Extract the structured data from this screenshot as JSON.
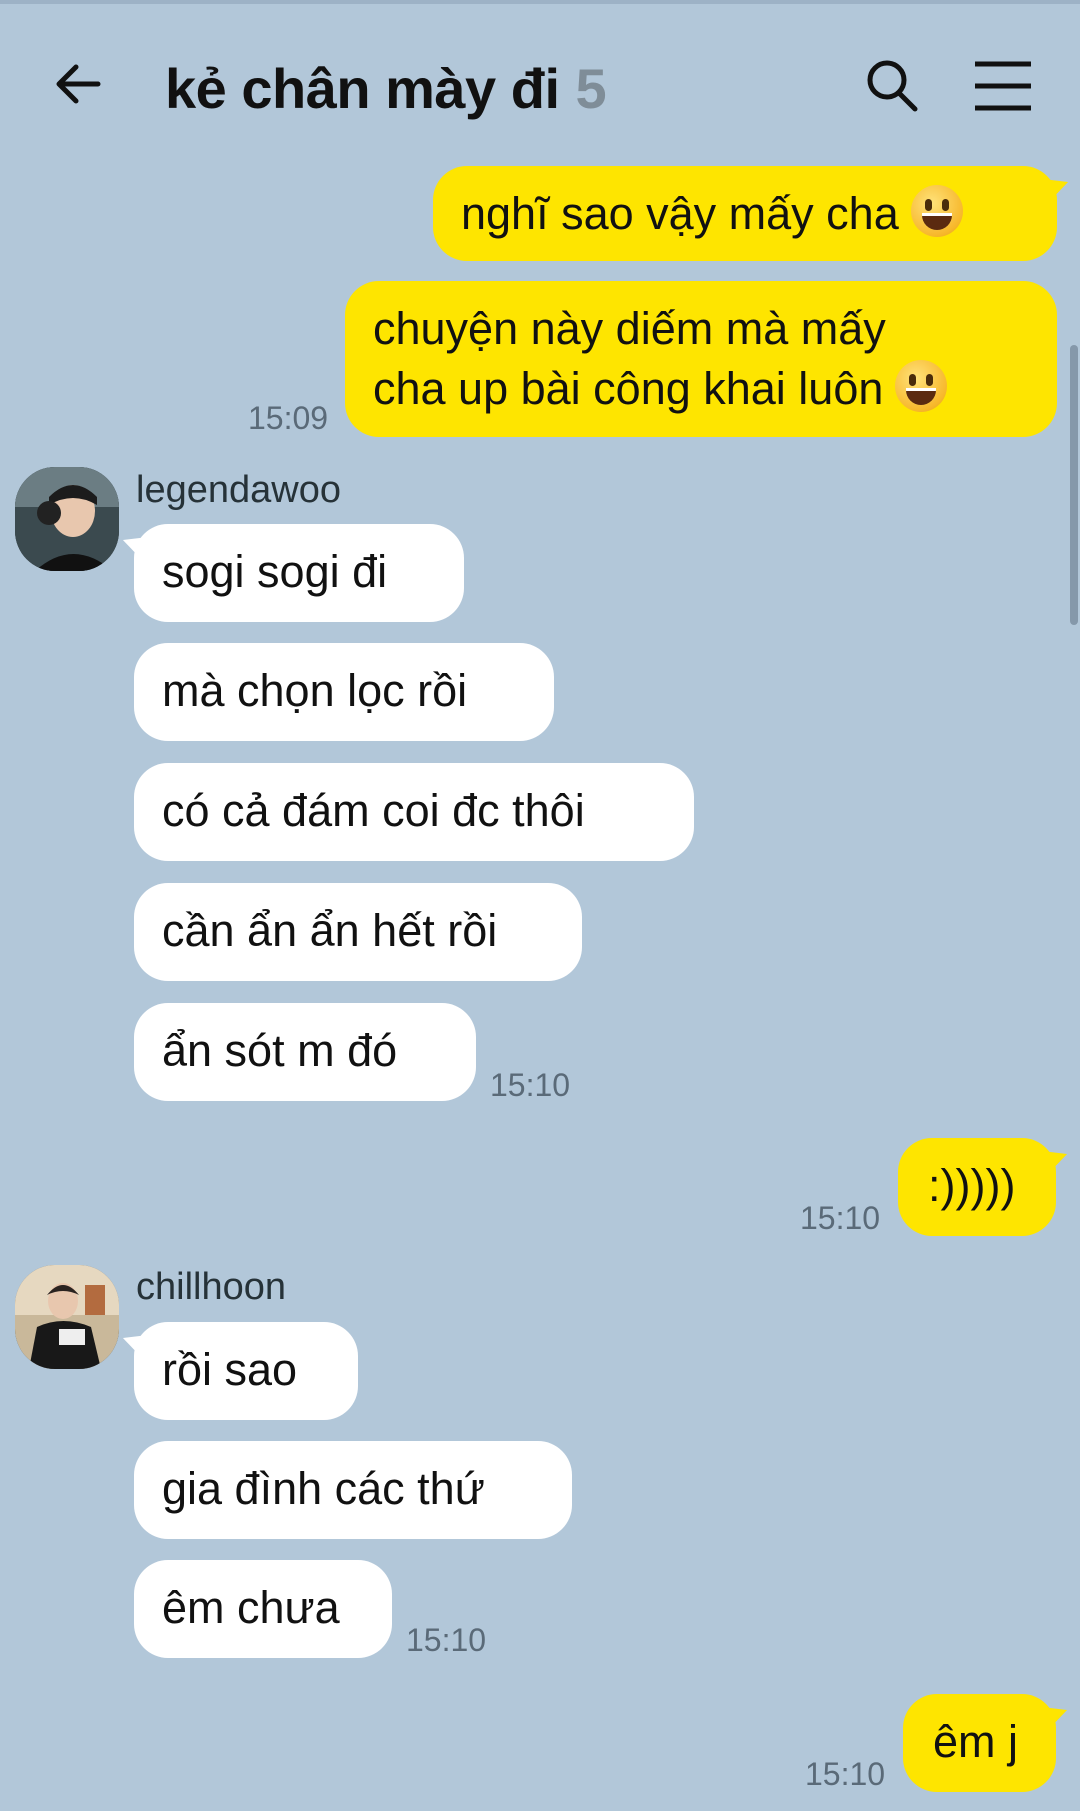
{
  "header": {
    "title": "kẻ chân mày đi",
    "member_count": "5"
  },
  "messages": [
    {
      "sender": "me",
      "text": "nghĩ sao vậy mấy cha",
      "emoji": "grinning-face"
    },
    {
      "sender": "me",
      "lines": [
        "chuyện này diếm mà mấy",
        "cha up bài công khai luôn"
      ],
      "emoji": "grinning-face",
      "time": "15:09"
    },
    {
      "sender": "legendawoo",
      "text": "sogi sogi đi"
    },
    {
      "sender": "legendawoo",
      "text": "mà chọn lọc rồi"
    },
    {
      "sender": "legendawoo",
      "text": "có cả đám coi đc thôi"
    },
    {
      "sender": "legendawoo",
      "text": "cần ẩn ẩn hết rồi"
    },
    {
      "sender": "legendawoo",
      "text": "ẩn sót m đó",
      "time": "15:10"
    },
    {
      "sender": "me",
      "text": ":)))))",
      "time": "15:10"
    },
    {
      "sender": "chillhoon",
      "text": "rồi sao"
    },
    {
      "sender": "chillhoon",
      "text": "gia đình các thứ"
    },
    {
      "sender": "chillhoon",
      "text": "êm chưa",
      "time": "15:10"
    },
    {
      "sender": "me",
      "text": "êm j",
      "time": "15:10"
    }
  ],
  "colors": {
    "background": "#b2c7d9",
    "my_bubble": "#fee500",
    "their_bubble": "#ffffff"
  },
  "icons": [
    "back-arrow-icon",
    "search-icon",
    "menu-icon",
    "grinning-face-emoji"
  ]
}
